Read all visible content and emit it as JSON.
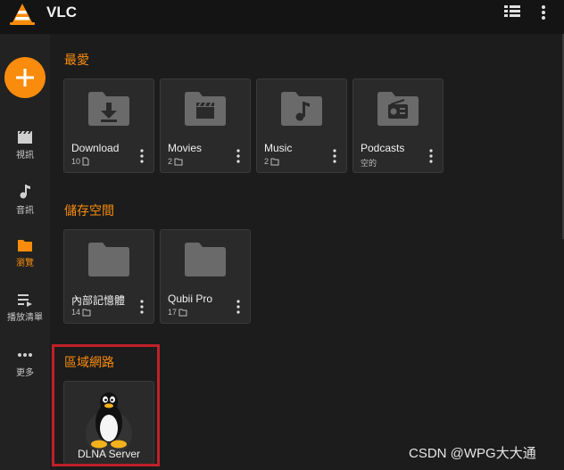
{
  "app": {
    "title": "VLC",
    "brand_color": "#f98c0c"
  },
  "toolbar": {
    "display_icon": "list-view-icon",
    "menu_icon": "more-vert-icon"
  },
  "sidebar": {
    "fab_icon": "plus-icon",
    "items": [
      {
        "label": "視訊",
        "icon": "movie-icon",
        "active": false
      },
      {
        "label": "音訊",
        "icon": "music-note-icon",
        "active": false
      },
      {
        "label": "瀏覽",
        "icon": "folder-icon",
        "active": true
      },
      {
        "label": "播放清單",
        "icon": "playlist-icon",
        "active": false
      },
      {
        "label": "更多",
        "icon": "more-horiz-icon",
        "active": false
      }
    ]
  },
  "sections": {
    "favorites": {
      "title": "最愛",
      "items": [
        {
          "name": "Download",
          "count": "10",
          "count_icon": "file-icon",
          "icon": "download-folder-icon"
        },
        {
          "name": "Movies",
          "count": "2",
          "count_icon": "folder-icon",
          "icon": "movie-folder-icon"
        },
        {
          "name": "Music",
          "count": "2",
          "count_icon": "folder-icon",
          "icon": "music-folder-icon"
        },
        {
          "name": "Podcasts",
          "count": "空的",
          "count_icon": "",
          "icon": "radio-folder-icon"
        }
      ]
    },
    "storage": {
      "title": "儲存空間",
      "items": [
        {
          "name": "內部記憶體",
          "count": "14",
          "count_icon": "folder-icon",
          "icon": "folder-icon"
        },
        {
          "name": "Qubii Pro",
          "count": "17",
          "count_icon": "folder-icon",
          "icon": "folder-icon"
        }
      ]
    },
    "local_network": {
      "title": "區域網路",
      "items": [
        {
          "name": "DLNA Server",
          "icon": "linux-tux-icon"
        }
      ]
    }
  },
  "annotation": {
    "highlight_color": "#c0202a"
  },
  "watermark": {
    "text": "CSDN @WPG大大通"
  }
}
